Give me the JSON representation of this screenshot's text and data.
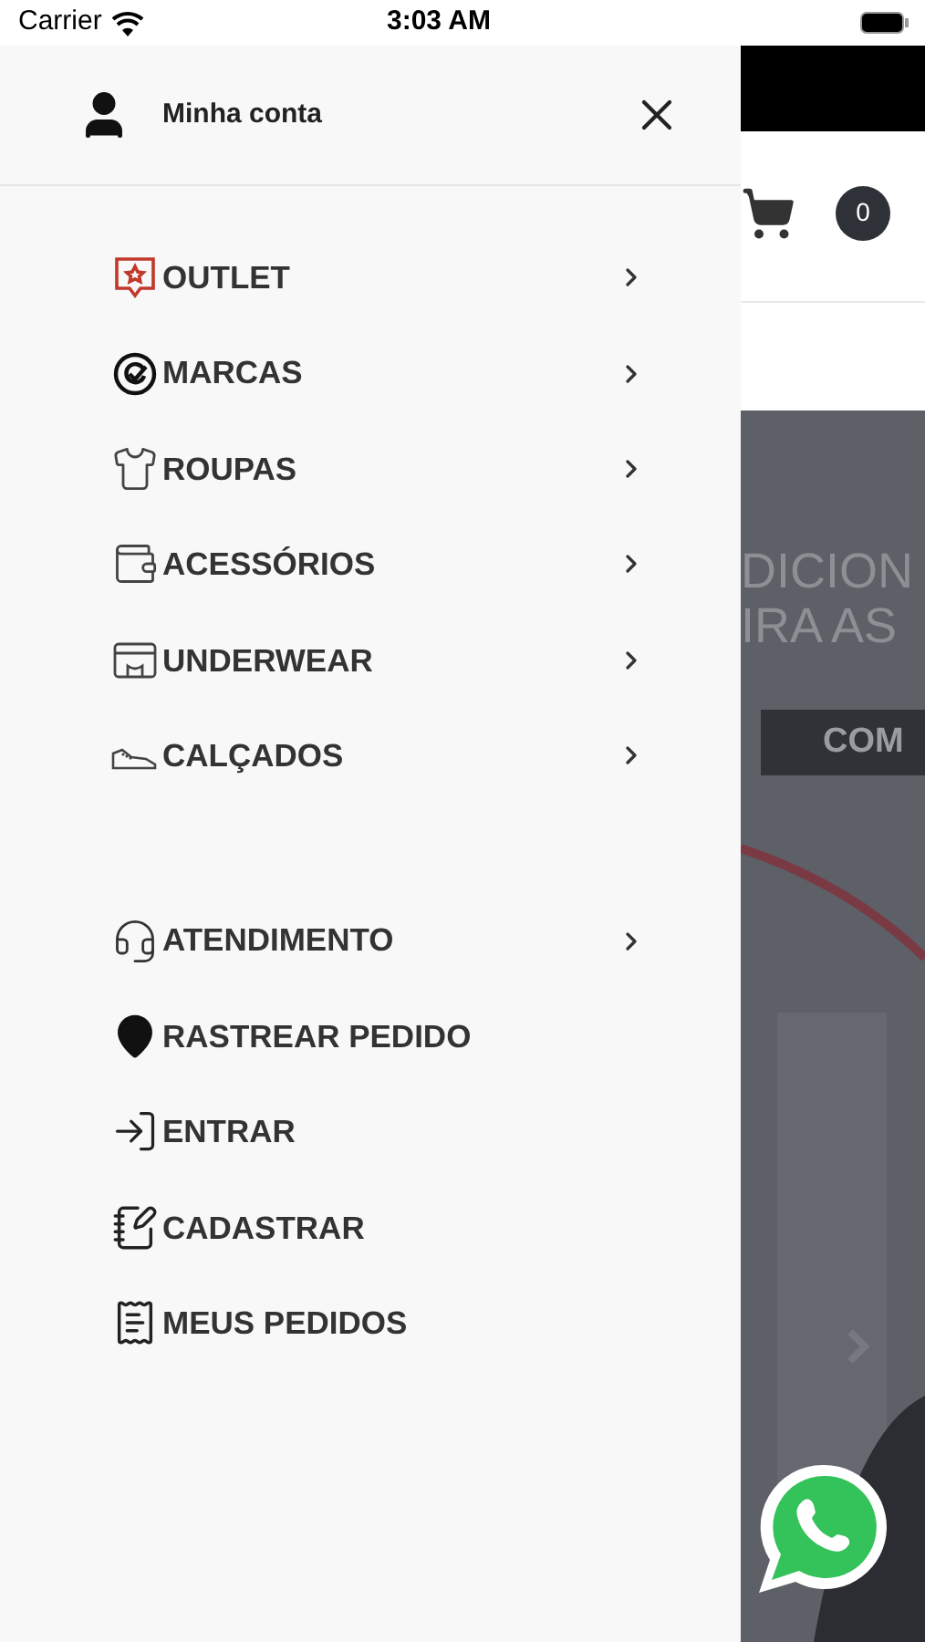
{
  "status_bar": {
    "carrier": "Carrier",
    "time": "3:03 AM"
  },
  "drawer": {
    "account_label": "Minha conta",
    "menu_groups": [
      [
        {
          "kind": "outlet",
          "label": "OUTLET",
          "has_arrow": true
        },
        {
          "kind": "brands",
          "label": "MARCAS",
          "has_arrow": true
        },
        {
          "kind": "clothes",
          "label": "ROUPAS",
          "has_arrow": true
        },
        {
          "kind": "accessories",
          "label": "ACESSÓRIOS",
          "has_arrow": true
        },
        {
          "kind": "underwear",
          "label": "UNDERWEAR",
          "has_arrow": true
        },
        {
          "kind": "shoes",
          "label": "CALÇADOS",
          "has_arrow": true
        }
      ],
      [
        {
          "kind": "support",
          "label": "ATENDIMENTO",
          "has_arrow": true
        },
        {
          "kind": "track",
          "label": "RASTREAR PEDIDO",
          "has_arrow": false
        },
        {
          "kind": "login",
          "label": "ENTRAR",
          "has_arrow": false
        },
        {
          "kind": "register",
          "label": "CADASTRAR",
          "has_arrow": false
        },
        {
          "kind": "orders",
          "label": "MEUS PEDIDOS",
          "has_arrow": false
        }
      ]
    ]
  },
  "background_page": {
    "cart_count": "0",
    "banner_lines": [
      "DICION",
      "IRA AS"
    ],
    "banner_button": "COM"
  }
}
